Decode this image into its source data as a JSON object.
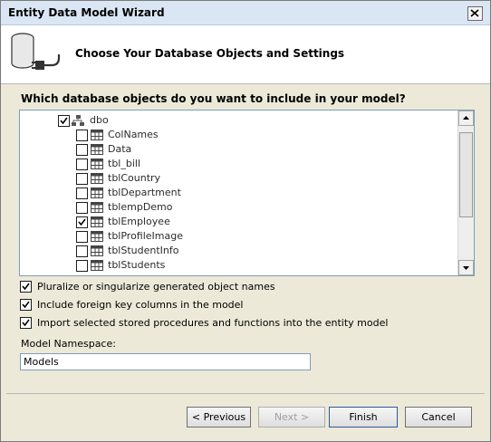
{
  "window": {
    "title": "Entity Data Model Wizard"
  },
  "header": {
    "title": "Choose Your Database Objects and Settings"
  },
  "objects": {
    "question": "Which database objects do you want to include in your model?",
    "schema": {
      "label": "dbo",
      "checked": true
    },
    "tables": [
      {
        "label": "ColNames",
        "checked": false
      },
      {
        "label": "Data",
        "checked": false
      },
      {
        "label": "tbl_bill",
        "checked": false
      },
      {
        "label": "tblCountry",
        "checked": false
      },
      {
        "label": "tblDepartment",
        "checked": false
      },
      {
        "label": "tblempDemo",
        "checked": false
      },
      {
        "label": "tblEmployee",
        "checked": true
      },
      {
        "label": "tblProfileImage",
        "checked": false
      },
      {
        "label": "tblStudentInfo",
        "checked": false
      },
      {
        "label": "tblStudents",
        "checked": false
      }
    ]
  },
  "options": [
    {
      "label": "Pluralize or singularize generated object names",
      "checked": true
    },
    {
      "label": "Include foreign key columns in the model",
      "checked": true
    },
    {
      "label": "Import selected stored procedures and functions into the entity model",
      "checked": true
    }
  ],
  "namespace": {
    "label": "Model Namespace:",
    "value": "Models"
  },
  "buttons": {
    "previous": "< Previous",
    "next": "Next >",
    "finish": "Finish",
    "cancel": "Cancel"
  }
}
